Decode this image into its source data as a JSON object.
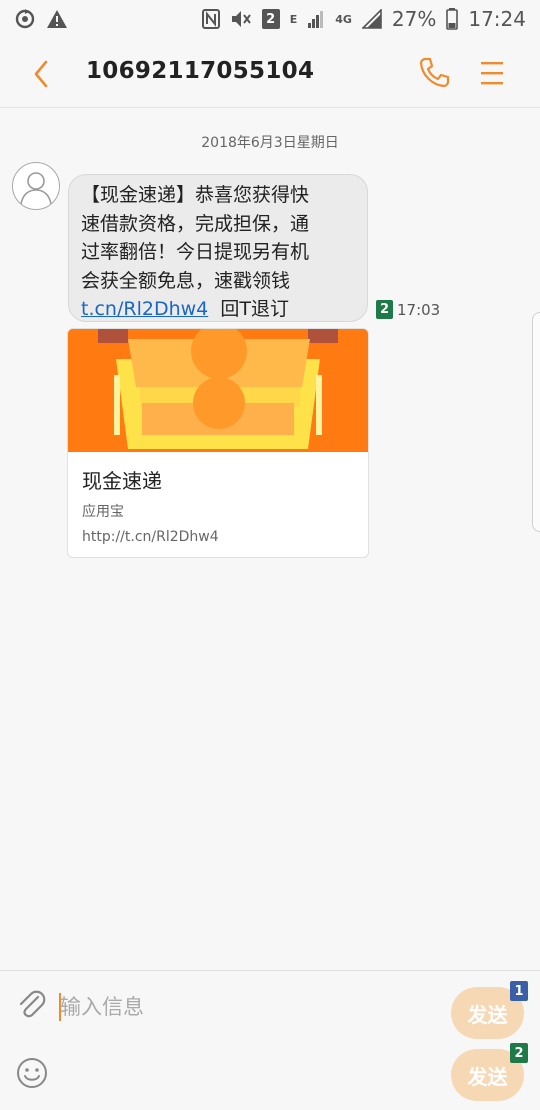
{
  "status_bar": {
    "sim_indicator": "2",
    "network_label": "4G",
    "roaming_label": "E",
    "battery_percent": "27%",
    "time": "17:24"
  },
  "header": {
    "contact_number": "10692117055104"
  },
  "conversation": {
    "date_separator": "2018年6月3日星期日",
    "message": {
      "lines": [
        "【现金速递】恭喜您获得快",
        "速借款资格，完成担保，通",
        "过率翻倍！今日提现另有机",
        "会获全额免息，速戳领钱"
      ],
      "link_text": "t.cn/Rl2Dhw4",
      "suffix": "回T退订",
      "sim": "2",
      "time": "17:03"
    },
    "link_preview": {
      "title": "现金速递",
      "source": "应用宝",
      "url": "http://t.cn/Rl2Dhw4"
    }
  },
  "composer": {
    "placeholder": "输入信息",
    "send_label": "发送",
    "sim1_label": "1",
    "sim2_label": "2"
  },
  "colors": {
    "accent": "#f08a2e",
    "link": "#1a66c4",
    "send_button": "#f6d8b4",
    "sim1": "#3a5fa8",
    "sim2": "#1f7a4a",
    "preview_bg": "#ff7a10"
  }
}
